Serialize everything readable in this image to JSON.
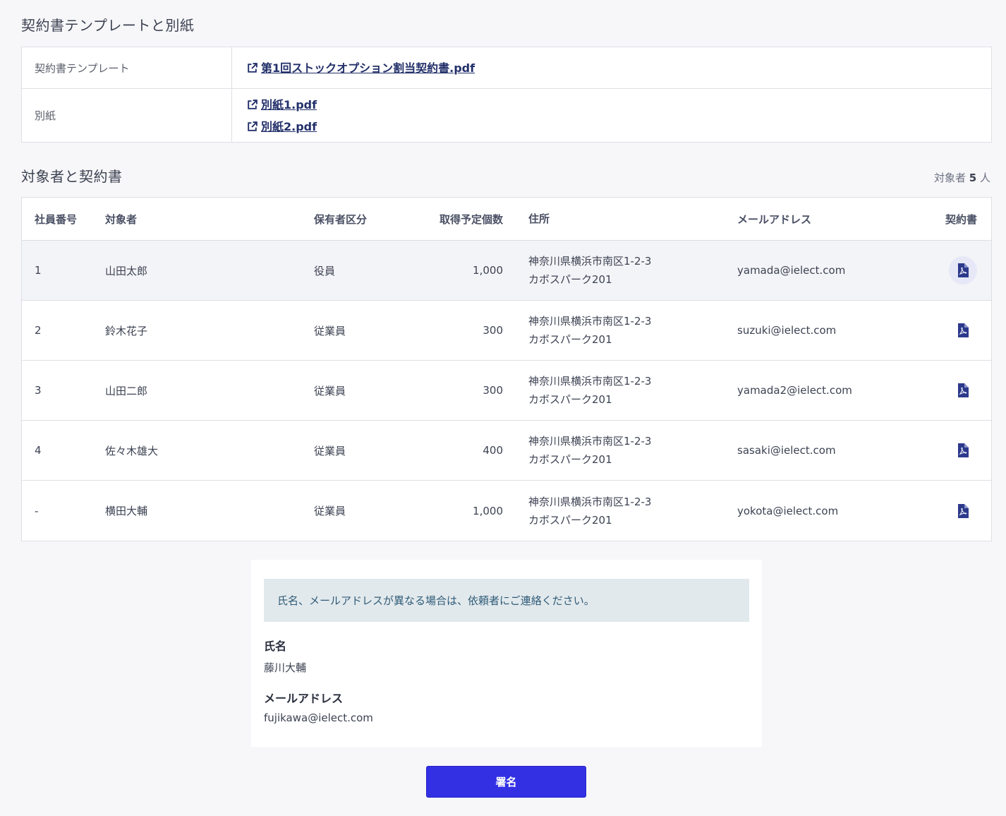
{
  "templates_section": {
    "title": "契約書テンプレートと別紙",
    "template_label": "契約書テンプレート",
    "template_file": "第1回ストックオプション割当契約書.pdf",
    "attachment_label": "別紙",
    "attachments": [
      "別紙1.pdf",
      "別紙2.pdf"
    ],
    "link_icon": "external-link-icon"
  },
  "participants_section": {
    "title": "対象者と契約書",
    "count_prefix": "対象者",
    "count_value": "5",
    "count_unit": "人",
    "columns": [
      "社員番号",
      "対象者",
      "保有者区分",
      "取得予定個数",
      "住所",
      "メールアドレス",
      "契約書"
    ],
    "rows": [
      {
        "no": "1",
        "name": "山田太郎",
        "type": "役員",
        "qty": "1,000",
        "addr1": "神奈川県横浜市南区1-2-3",
        "addr2": "カボスパーク201",
        "email": "yamada@ielect.com"
      },
      {
        "no": "2",
        "name": "鈴木花子",
        "type": "従業員",
        "qty": "300",
        "addr1": "神奈川県横浜市南区1-2-3",
        "addr2": "カボスパーク201",
        "email": "suzuki@ielect.com"
      },
      {
        "no": "3",
        "name": "山田二郎",
        "type": "従業員",
        "qty": "300",
        "addr1": "神奈川県横浜市南区1-2-3",
        "addr2": "カボスパーク201",
        "email": "yamada2@ielect.com"
      },
      {
        "no": "4",
        "name": "佐々木雄大",
        "type": "従業員",
        "qty": "400",
        "addr1": "神奈川県横浜市南区1-2-3",
        "addr2": "カボスパーク201",
        "email": "sasaki@ielect.com"
      },
      {
        "no": "-",
        "name": "横田大輔",
        "type": "従業員",
        "qty": "1,000",
        "addr1": "神奈川県横浜市南区1-2-3",
        "addr2": "カボスパーク201",
        "email": "yokota@ielect.com"
      }
    ],
    "doc_icon": "pdf-file-icon"
  },
  "signer": {
    "notice": "氏名、メールアドレスが異なる場合は、依頼者にご連絡ください。",
    "name_label": "氏名",
    "name_value": "藤川大輔",
    "email_label": "メールアドレス",
    "email_value": "fujikawa@ielect.com"
  },
  "sign_button": "署名",
  "colors": {
    "accent": "#3330e4",
    "link": "#23306a",
    "notice_bg": "#e2e9ec",
    "background": "#f7f7f9"
  }
}
